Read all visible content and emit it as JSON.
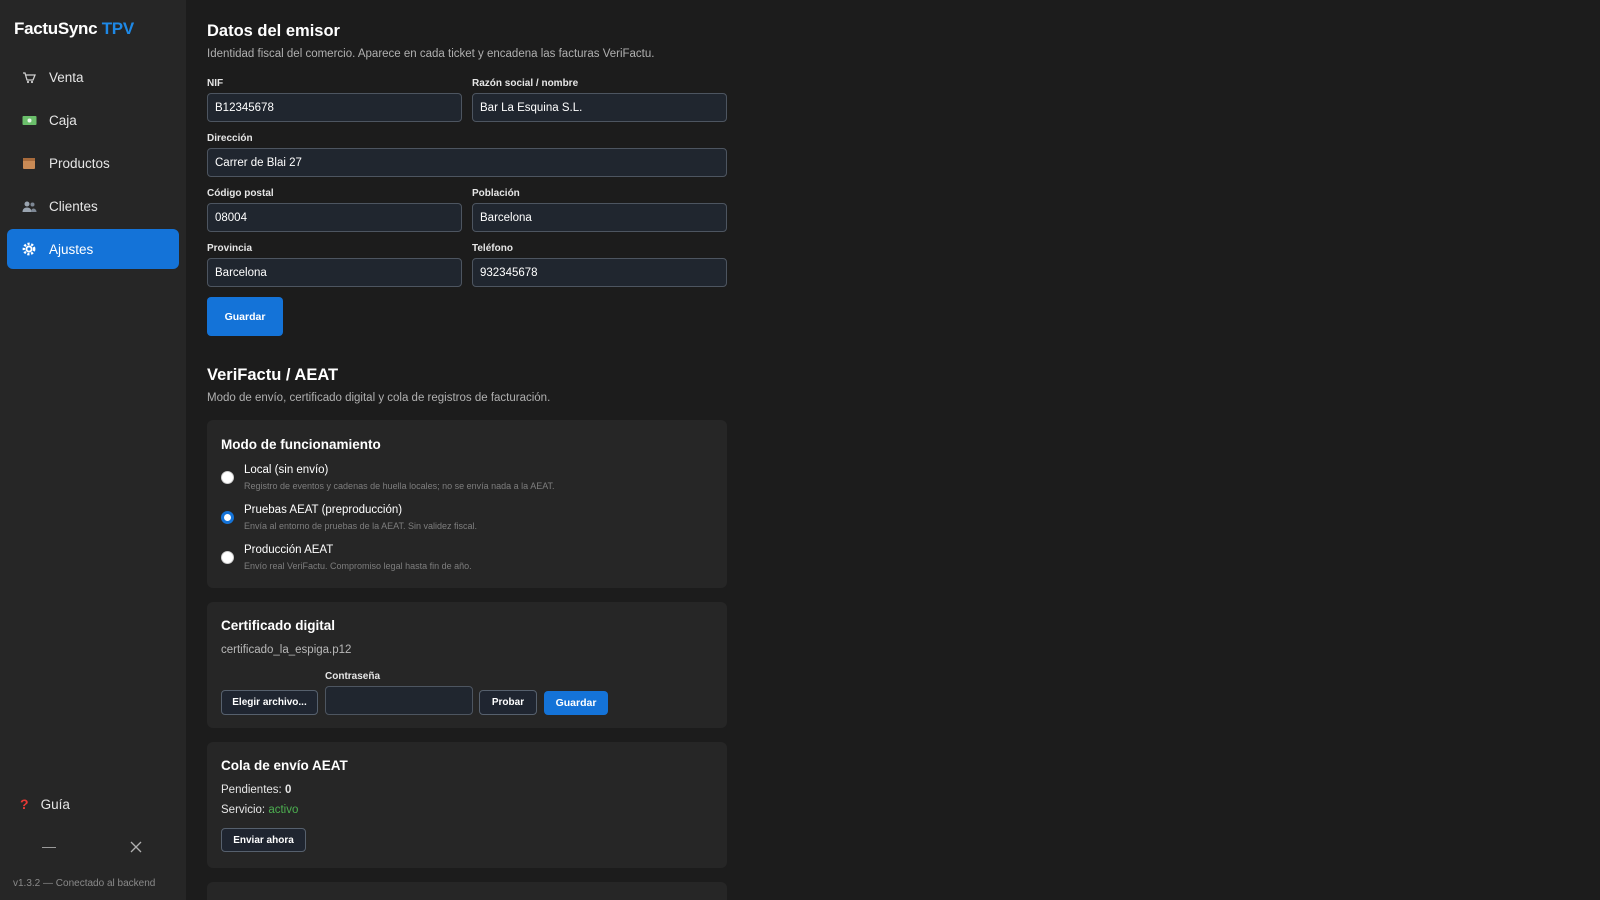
{
  "app": {
    "name": "FactuSync",
    "name_accent": "TPV"
  },
  "sidebar": {
    "items": [
      {
        "label": "Venta",
        "icon": "cart-icon"
      },
      {
        "label": "Caja",
        "icon": "cash-icon"
      },
      {
        "label": "Productos",
        "icon": "box-icon"
      },
      {
        "label": "Clientes",
        "icon": "users-icon"
      },
      {
        "label": "Ajustes",
        "icon": "gear-icon",
        "active": true
      }
    ],
    "guide_label": "Guía",
    "version": "v1.3.2 — Conectado al backend"
  },
  "issuer": {
    "title": "Datos del emisor",
    "subtitle": "Identidad fiscal del comercio. Aparece en cada ticket y encadena las facturas VeriFactu.",
    "fields": {
      "nif": {
        "label": "NIF",
        "value": "B12345678"
      },
      "razon": {
        "label": "Razón social / nombre",
        "value": "Bar La Esquina S.L."
      },
      "direccion": {
        "label": "Dirección",
        "value": "Carrer de Blai 27"
      },
      "cp": {
        "label": "Código postal",
        "value": "08004"
      },
      "poblacion": {
        "label": "Población",
        "value": "Barcelona"
      },
      "provincia": {
        "label": "Provincia",
        "value": "Barcelona"
      },
      "telefono": {
        "label": "Teléfono",
        "value": "932345678"
      }
    },
    "save_label": "Guardar"
  },
  "verifactu": {
    "title": "VeriFactu / AEAT",
    "subtitle": "Modo de envío, certificado digital y cola de registros de facturación.",
    "mode": {
      "title": "Modo de funcionamiento",
      "options": [
        {
          "label": "Local (sin envío)",
          "desc": "Registro de eventos y cadenas de huella locales; no se envía nada a la AEAT.",
          "selected": false
        },
        {
          "label": "Pruebas AEAT (preproducción)",
          "desc": "Envía al entorno de pruebas de la AEAT. Sin validez fiscal.",
          "selected": true
        },
        {
          "label": "Producción AEAT",
          "desc": "Envío real VeriFactu. Compromiso legal hasta fin de año.",
          "selected": false
        }
      ]
    },
    "certificate": {
      "title": "Certificado digital",
      "filename": "certificado_la_espiga.p12",
      "choose_label": "Elegir archivo...",
      "password_label": "Contraseña",
      "password_value": "",
      "test_label": "Probar",
      "save_label": "Guardar"
    },
    "queue": {
      "title": "Cola de envío AEAT",
      "pending_label": "Pendientes:",
      "pending_value": "0",
      "service_label": "Servicio:",
      "service_value": "activo",
      "send_label": "Enviar ahora"
    }
  },
  "colors": {
    "accent": "#1473d8",
    "brand_accent": "#1e88e5",
    "status_ok": "#4caf50"
  }
}
